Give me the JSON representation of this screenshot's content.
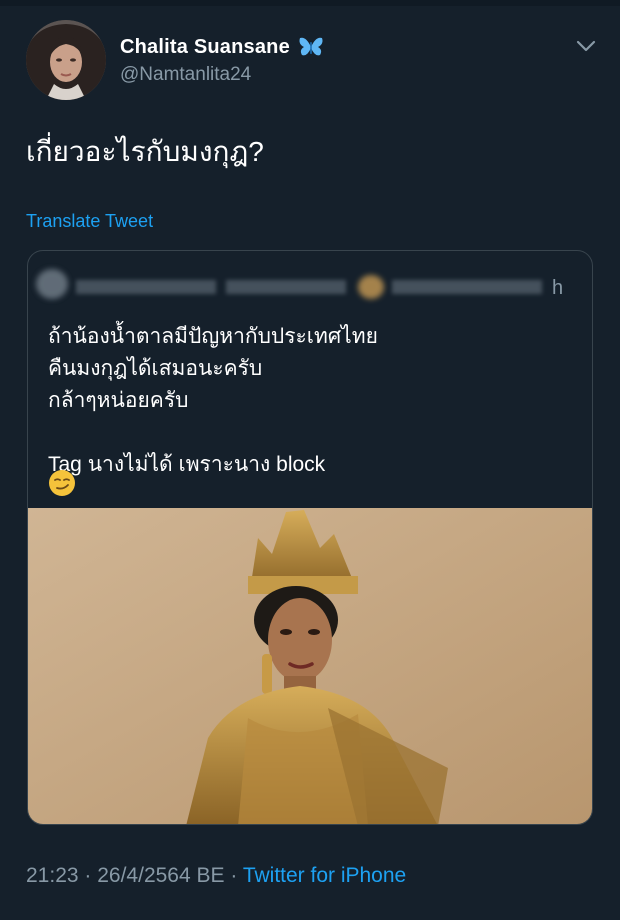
{
  "tweet": {
    "author_name": "Chalita Suansane",
    "author_handle": "@Namtanlita24",
    "text": "เกี่ยวอะไรกับมงกุฎ?",
    "translate_label": "Translate Tweet"
  },
  "quoted_tweet": {
    "time_suffix": "h",
    "text": "ถ้าน้องน้ำตาลมีปัญหากับประเทศไทย\nคืนมงกุฎได้เสมอนะครับ\nกล้าๆหน่อยครับ\n\nTag นางไม่ได้ เพราะนาง block"
  },
  "footer": {
    "time": "21:23",
    "separator": " · ",
    "date": "26/4/2564 BE",
    "source": "Twitter for iPhone"
  },
  "colors": {
    "background": "#15202b",
    "link": "#1da1f2",
    "secondary_text": "#8899a6",
    "border": "#38444d"
  },
  "icons": [
    "butterfly-icon",
    "chevron-down-icon",
    "smirk-emoji-icon"
  ]
}
